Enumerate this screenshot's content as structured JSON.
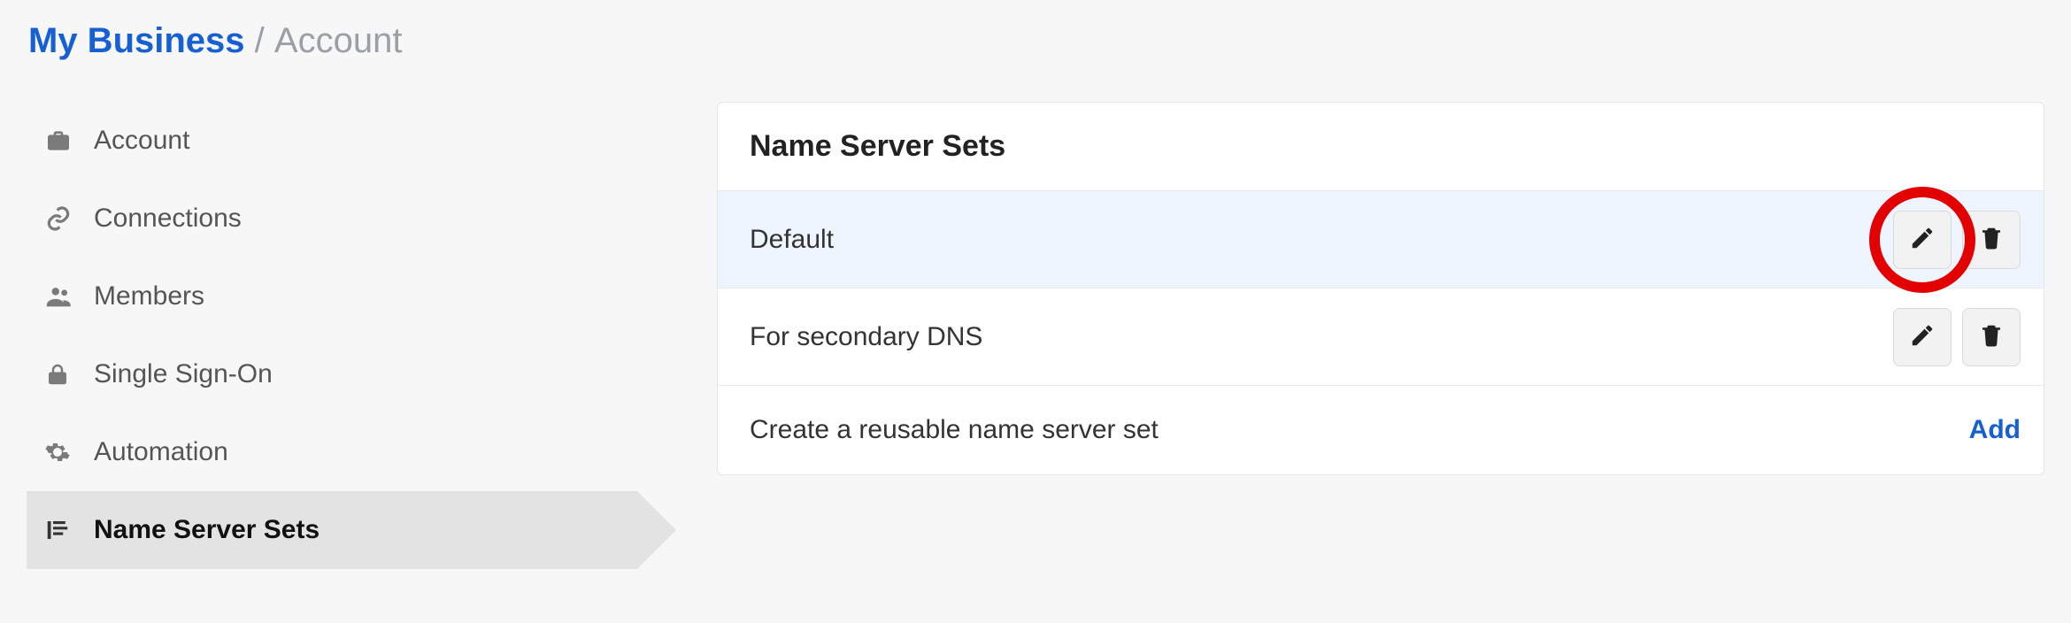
{
  "breadcrumb": {
    "link": "My Business",
    "separator": "/",
    "current": "Account"
  },
  "sidebar": {
    "items": [
      {
        "icon": "briefcase",
        "label": "Account"
      },
      {
        "icon": "link",
        "label": "Connections"
      },
      {
        "icon": "users",
        "label": "Members"
      },
      {
        "icon": "lock",
        "label": "Single Sign-On"
      },
      {
        "icon": "gear",
        "label": "Automation"
      },
      {
        "icon": "bars",
        "label": "Name Server Sets"
      }
    ],
    "active_index": 5
  },
  "panel": {
    "title": "Name Server Sets",
    "rows": [
      {
        "label": "Default",
        "selected": true
      },
      {
        "label": "For secondary DNS",
        "selected": false
      }
    ],
    "create_label": "Create a reusable name server set",
    "add_label": "Add"
  },
  "annotation": {
    "highlighted": "edit-button-row-0"
  }
}
